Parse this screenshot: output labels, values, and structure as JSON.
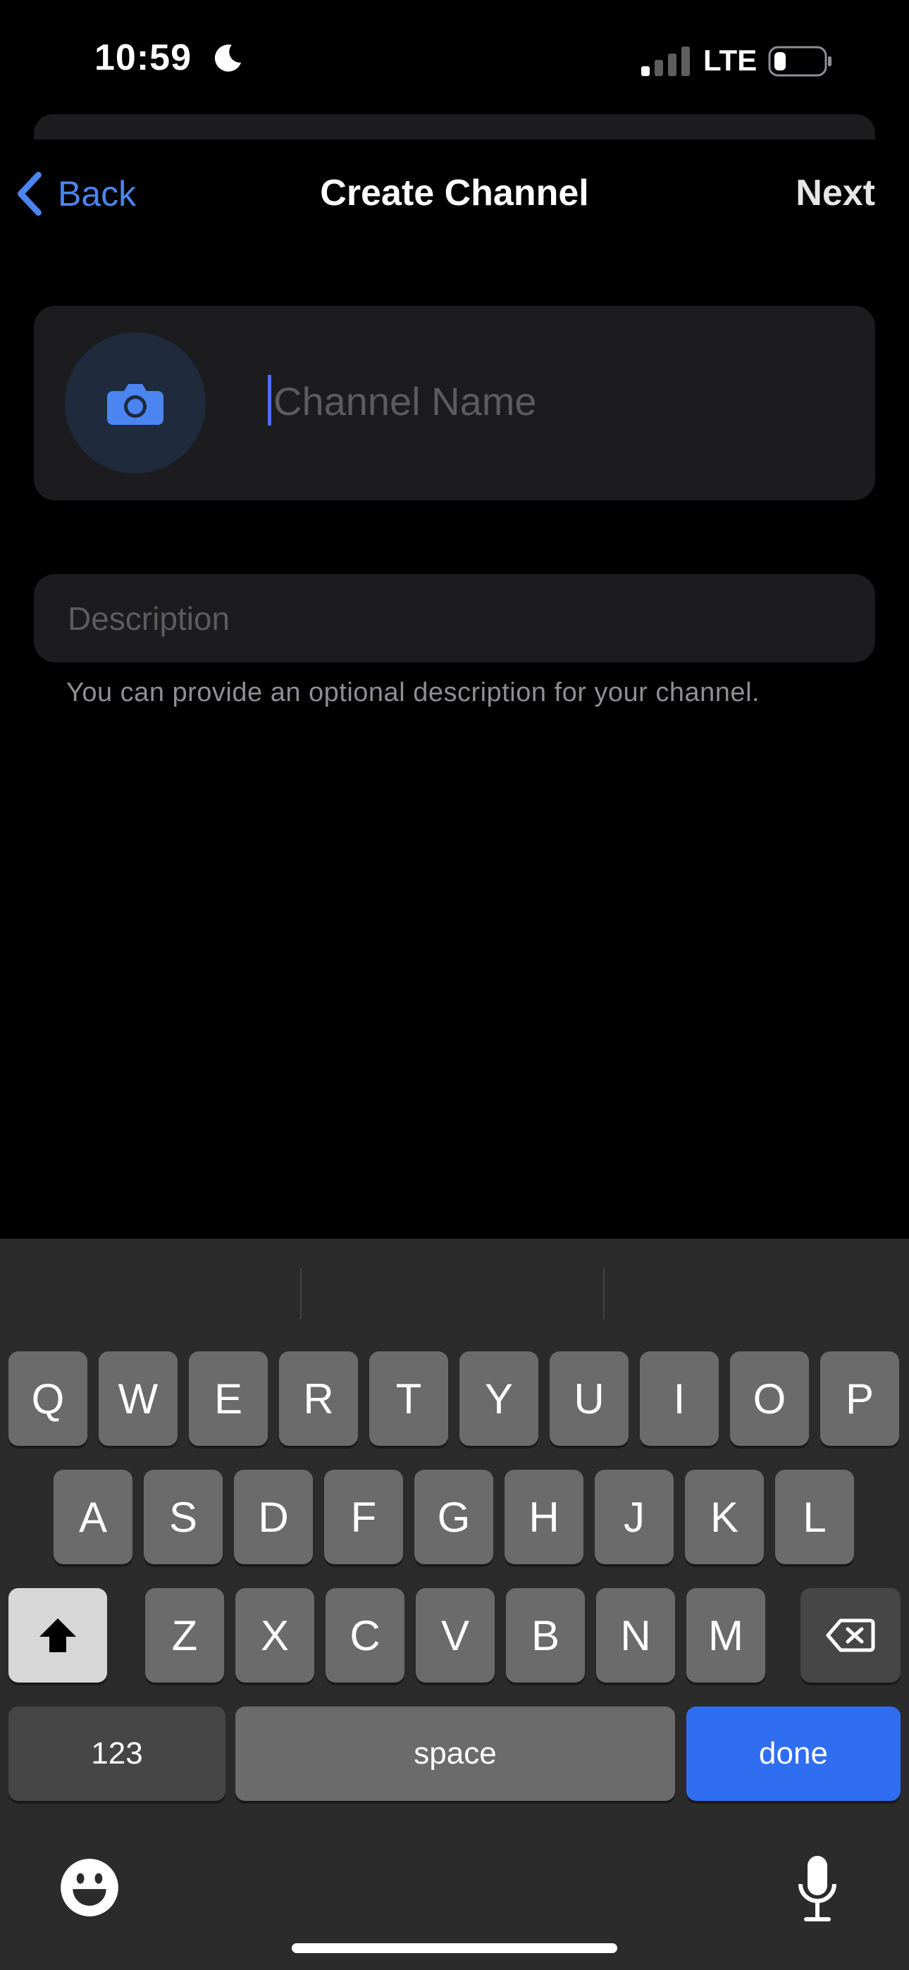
{
  "status_bar": {
    "time": "10:59",
    "network": "LTE"
  },
  "nav": {
    "back_label": "Back",
    "title": "Create Channel",
    "next_label": "Next"
  },
  "form": {
    "name_placeholder": "Channel Name",
    "name_value": "",
    "description_placeholder": "Description",
    "description_value": "",
    "description_hint": "You can provide an optional description for your channel."
  },
  "colors": {
    "accent": "#4b85f1",
    "done_key": "#2f6ef0",
    "background": "#000000",
    "card": "#1c1c1e"
  },
  "keyboard": {
    "row1": [
      "Q",
      "W",
      "E",
      "R",
      "T",
      "Y",
      "U",
      "I",
      "O",
      "P"
    ],
    "row2": [
      "A",
      "S",
      "D",
      "F",
      "G",
      "H",
      "J",
      "K",
      "L"
    ],
    "row3": [
      "Z",
      "X",
      "C",
      "V",
      "B",
      "N",
      "M"
    ],
    "numbers_label": "123",
    "space_label": "space",
    "done_label": "done"
  },
  "icons": {
    "moon": "moon-icon",
    "signal": "signal-icon",
    "battery": "battery-icon",
    "back": "chevron-left-icon",
    "camera": "camera-icon",
    "shift": "shift-icon",
    "delete": "delete-icon",
    "emoji": "emoji-icon",
    "mic": "microphone-icon"
  }
}
